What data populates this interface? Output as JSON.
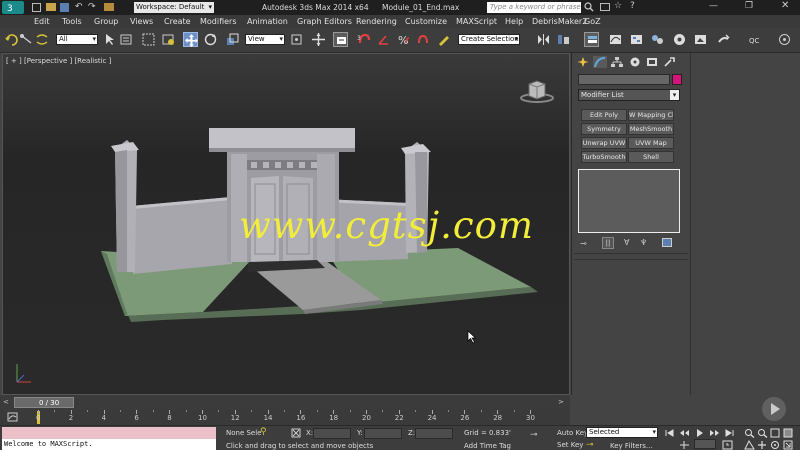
{
  "titlebar": {
    "workspace_label": "Workspace: Default",
    "app_title": "Autodesk 3ds Max  2014 x64",
    "file_name": "Module_01_End.max",
    "search_placeholder": "Type a keyword or phrase"
  },
  "menubar": {
    "items": [
      "Edit",
      "Tools",
      "Group",
      "Views",
      "Create",
      "Modifiers",
      "Animation",
      "Graph Editors",
      "Rendering",
      "Customize",
      "MAXScript",
      "Help",
      "DebrisMaker2",
      "GoZ"
    ]
  },
  "toolbar": {
    "selection_filter": "All",
    "ref_coord": "View",
    "named_selection": "Create Selection Se",
    "qc_label": "QC"
  },
  "viewport": {
    "label": "[ + ] [Perspective ] [Realistic ]",
    "watermark": "www.cgtsj.com"
  },
  "command_panel": {
    "modifier_list_label": "Modifier List",
    "name_field_color": "#d4147a",
    "buttons": [
      "Edit Poly",
      "W Mapping Cl",
      "Symmetry",
      "MeshSmooth",
      "Unwrap UVW",
      "UVW Map",
      "TurboSmooth",
      "Shell"
    ]
  },
  "timeline": {
    "slider_label": "0 / 30",
    "ticks": [
      "0",
      "2",
      "4",
      "6",
      "8",
      "10",
      "12",
      "14",
      "16",
      "18",
      "20",
      "22",
      "24",
      "26",
      "28",
      "30"
    ]
  },
  "statusbar": {
    "maxscript_text": "Welcome to MAXScript.",
    "selection_text": "None Sele",
    "x_label": "X:",
    "y_label": "Y:",
    "z_label": "Z:",
    "grid_text": "Grid = 0.833'",
    "prompt_text": "Click and drag to select and move objects",
    "add_time_tag": "Add Time Tag",
    "auto_key": "Auto Key",
    "set_key": "Set Key",
    "selected_dd": "Selected",
    "key_filters": "Key Filters..."
  }
}
